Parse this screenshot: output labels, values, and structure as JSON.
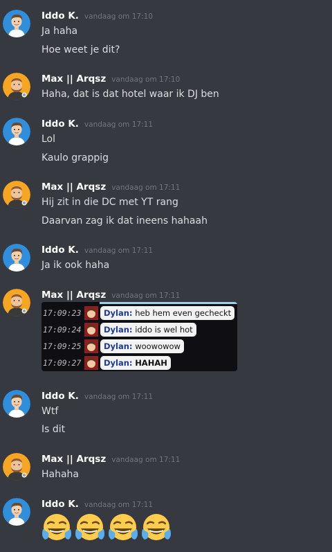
{
  "colors": {
    "background": "#36393f",
    "username": "#ffffff",
    "timestamp": "#72767d",
    "message_text": "#dcddde",
    "avatar_iddo_bg": "#2f8fdc",
    "avatar_max_bg": "#f6a623"
  },
  "messages": [
    {
      "author": "Iddo K.",
      "timestamp": "vandaag om 17:10",
      "avatar": "iddo",
      "lines": [
        "Ja haha",
        "Hoe weet je dit?"
      ]
    },
    {
      "author": "Max || Arqsz",
      "timestamp": "vandaag om 17:10",
      "avatar": "max",
      "lines": [
        "Haha, dat is dat hotel waar ik DJ ben"
      ]
    },
    {
      "author": "Iddo K.",
      "timestamp": "vandaag om 17:11",
      "avatar": "iddo",
      "lines": [
        "Lol",
        "Kaulo grappig"
      ]
    },
    {
      "author": "Max || Arqsz",
      "timestamp": "vandaag om 17:11",
      "avatar": "max",
      "lines": [
        "Hij zit in die DC met YT rang",
        "Daarvan zag ik dat ineens hahaah"
      ]
    },
    {
      "author": "Iddo K.",
      "timestamp": "vandaag om 17:11",
      "avatar": "iddo",
      "lines": [
        "Ja ik ook haha"
      ]
    },
    {
      "author": "Max || Arqsz",
      "timestamp": "vandaag om 17:11",
      "avatar": "max",
      "lines": [],
      "attachment": {
        "chat": [
          {
            "time": "17:09:23",
            "name": "Dylan:",
            "text": "heb hem even gecheckt"
          },
          {
            "time": "17:09:24",
            "name": "Dylan:",
            "text": "iddo is wel hot"
          },
          {
            "time": "17:09:25",
            "name": "Dylan:",
            "text": "woowowow"
          },
          {
            "time": "17:09:27",
            "name": "Dylan:",
            "text": "HAHAH"
          }
        ]
      }
    },
    {
      "author": "Iddo K.",
      "timestamp": "vandaag om 17:11",
      "avatar": "iddo",
      "lines": [
        "Wtf",
        "Is dit"
      ]
    },
    {
      "author": "Max || Arqsz",
      "timestamp": "vandaag om 17:11",
      "avatar": "max",
      "lines": [
        "Hahaha"
      ]
    },
    {
      "author": "Iddo K.",
      "timestamp": "vandaag om 17:11",
      "avatar": "iddo",
      "lines": [],
      "emojis": [
        "joy-emoji",
        "joy-emoji",
        "joy-emoji",
        "joy-emoji"
      ]
    }
  ]
}
